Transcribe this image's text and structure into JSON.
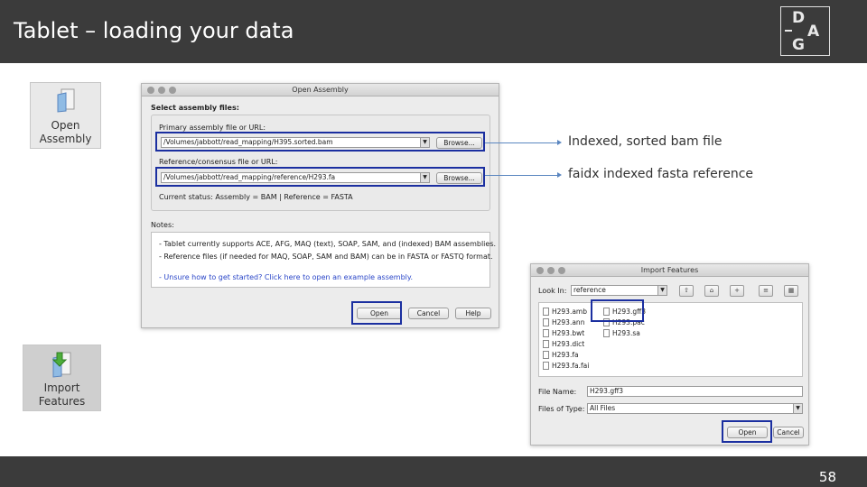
{
  "slide": {
    "title": "Tablet – loading your data",
    "page_number": "58"
  },
  "logo": {
    "letters": [
      "D",
      "A",
      "G"
    ]
  },
  "tools": {
    "open_assembly": {
      "line1": "Open",
      "line2": "Assembly"
    },
    "import_features": {
      "line1": "Import",
      "line2": "Features"
    }
  },
  "open_dialog": {
    "title": "Open Assembly",
    "section_label": "Select assembly files:",
    "primary_label": "Primary assembly file or URL:",
    "primary_value": "/Volumes/jabbott/read_mapping/H395.sorted.bam",
    "reference_label": "Reference/consensus file or URL:",
    "reference_value": "/Volumes/jabbott/read_mapping/reference/H293.fa",
    "browse_label": "Browse...",
    "status_text": "Current status: Assembly = BAM | Reference = FASTA",
    "notes_label": "Notes:",
    "note1": "- Tablet currently supports ACE, AFG, MAQ (text), SOAP, SAM, and (indexed) BAM assemblies.",
    "note2": "- Reference files (if needed for MAQ, SOAP, SAM and BAM) can be in FASTA or FASTQ format.",
    "note3": "- Unsure how to get started? Click here to open an example assembly.",
    "open_label": "Open",
    "cancel_label": "Cancel",
    "help_label": "Help"
  },
  "callouts": {
    "bam": "Indexed, sorted bam file",
    "fasta": "faidx indexed fasta reference"
  },
  "import_dialog": {
    "title": "Import Features",
    "look_in_label": "Look In:",
    "look_in_value": "reference",
    "files_col1": [
      "H293.amb",
      "H293.ann",
      "H293.bwt",
      "H293.dict",
      "H293.fa",
      "H293.fa.fai"
    ],
    "files_col2": [
      "H293.gff3",
      "H293.pac",
      "H293.sa"
    ],
    "file_name_label": "File Name:",
    "file_name_value": "H293.gff3",
    "file_type_label": "Files of Type:",
    "file_type_value": "All Files",
    "open_label": "Open",
    "cancel_label": "Cancel"
  },
  "colors": {
    "header": "#3b3b3b",
    "highlight": "#1b2fa0",
    "callout": "#5a86c0"
  }
}
